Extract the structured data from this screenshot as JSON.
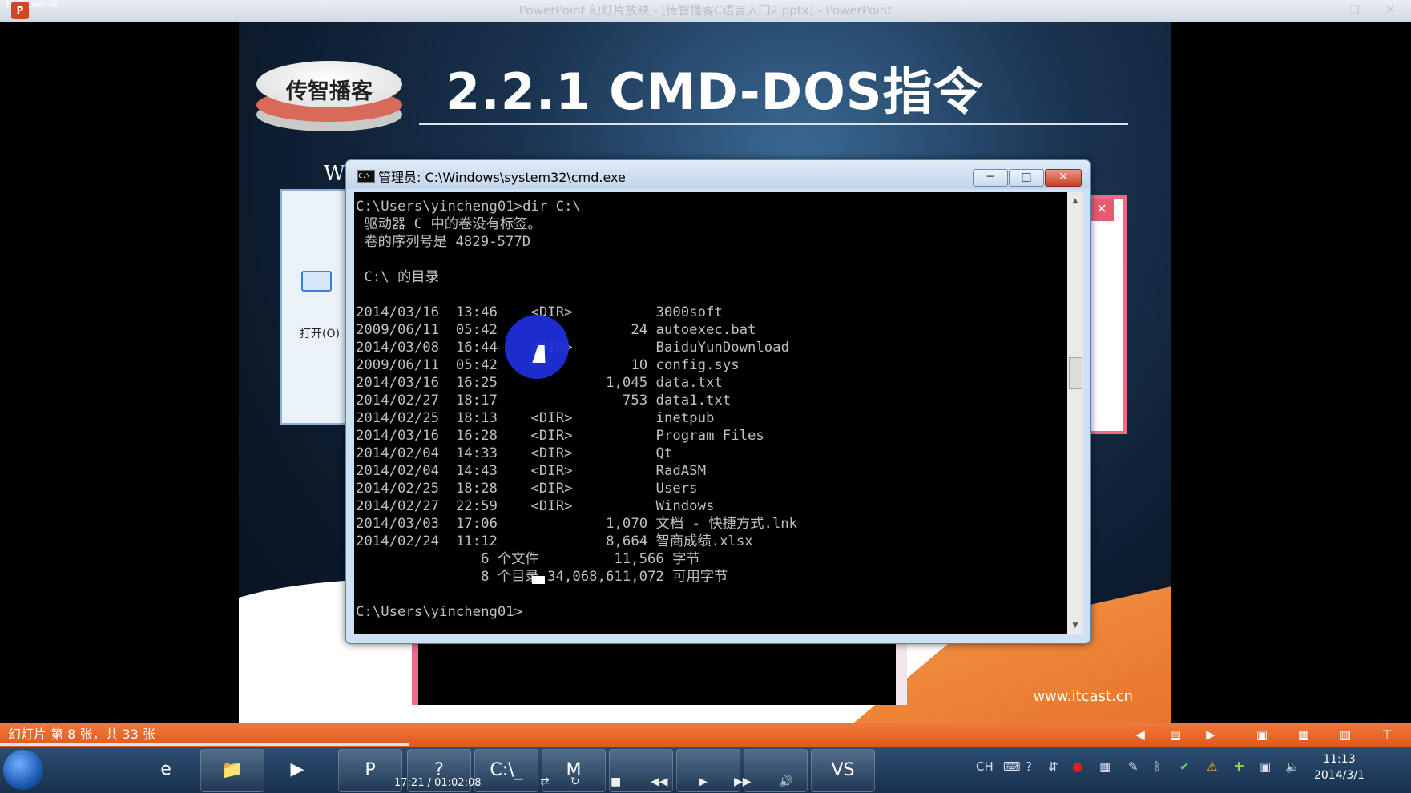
{
  "window": {
    "left_text": "Helloworld",
    "app_icon": "P",
    "title": "PowerPoint 幻灯片放映 - [传智播客C语言入门2.pptx] - PowerPoint",
    "controls": "– ❐ ✕"
  },
  "slide": {
    "logo_text": "传智播客",
    "title": "2.2.1  CMD-DOS指令",
    "website": "www.itcast.cn",
    "bg_window_label": "打开(O)",
    "bg_window_letter": "W",
    "bg_close": "✕"
  },
  "cmd": {
    "title": "管理员: C:\\Windows\\system32\\cmd.exe",
    "icon_text": "C:\\_",
    "min_label": "─",
    "max_label": "□",
    "close_label": "✕",
    "lines": [
      "C:\\Users\\yincheng01>dir C:\\",
      " 驱动器 C 中的卷没有标签。",
      " 卷的序列号是 4829-577D",
      "",
      " C:\\ 的目录",
      "",
      "2014/03/16  13:46    <DIR>          3000soft",
      "2009/06/11  05:42                24 autoexec.bat",
      "2014/03/08  16:44    <DIR>          BaiduYunDownload",
      "2009/06/11  05:42                10 config.sys",
      "2014/03/16  16:25             1,045 data.txt",
      "2014/02/27  18:17               753 data1.txt",
      "2014/02/25  18:13    <DIR>          inetpub",
      "2014/03/16  16:28    <DIR>          Program Files",
      "2014/02/04  14:33    <DIR>          Qt",
      "2014/02/04  14:43    <DIR>          RadASM",
      "2014/02/25  18:28    <DIR>          Users",
      "2014/02/27  22:59    <DIR>          Windows",
      "2014/03/03  17:06             1,070 文档 - 快捷方式.lnk",
      "2014/02/24  11:12             8,664 智商成绩.xlsx",
      "               6 个文件         11,566 字节",
      "               8 个目录 34,068,611,072 可用字节",
      "",
      "C:\\Users\\yincheng01>"
    ]
  },
  "status": {
    "text": "幻灯片 第 8 张，共 33 张",
    "icons": [
      "◀",
      "▤",
      "▶",
      "▣",
      "▦",
      "▥",
      "⊤"
    ],
    "progress": 0.29
  },
  "taskbar": {
    "media_time": "17:21 / 01:02:08",
    "apps": [
      "e",
      "📁",
      "▶",
      "P",
      "?",
      "C:\\_",
      "M",
      "",
      "",
      "",
      "",
      "VS"
    ],
    "media_controls": [
      "⇄",
      "↻",
      "■",
      "◀◀",
      "▶",
      "▶▶",
      "🔊"
    ],
    "tray": [
      "CH",
      "⌨",
      "?",
      "⇵",
      "●",
      "▦",
      "✎",
      "ᛒ",
      "✔",
      "⚠",
      "✚",
      "▣",
      "🔈"
    ],
    "clock_time": "11:13",
    "clock_date": "2014/3/1"
  }
}
